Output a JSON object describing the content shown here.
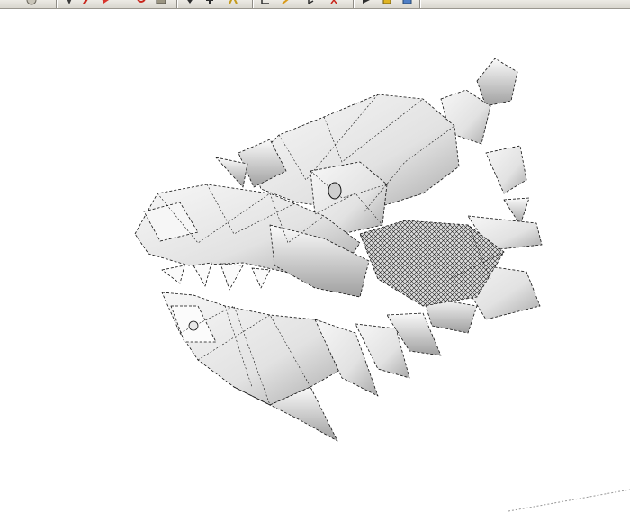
{
  "toolbar": {
    "tools": [
      {
        "icon": "orbit-icon"
      },
      {
        "icon": "select-arrow-icon"
      },
      {
        "icon": "pencil-red-icon"
      },
      {
        "icon": "eraser-icon"
      },
      {
        "icon": "rotate-red-icon"
      },
      {
        "icon": "paint-bucket-icon"
      },
      {
        "icon": "push-pull-icon"
      },
      {
        "icon": "move-icon"
      },
      {
        "icon": "follow-me-icon"
      },
      {
        "icon": "tape-measure-icon"
      },
      {
        "icon": "protractor-icon"
      },
      {
        "icon": "axes-icon"
      },
      {
        "icon": "walk-icon"
      },
      {
        "icon": "look-around-icon"
      },
      {
        "icon": "section-plane-icon"
      }
    ]
  },
  "viewport": {
    "model": "dragon-head-mesh",
    "colors": {
      "mesh_fill": "#e9e9e9",
      "mesh_shadow": "#a9a9a9",
      "edge": "#111111",
      "ground_axis": "#9a9a9a"
    }
  }
}
